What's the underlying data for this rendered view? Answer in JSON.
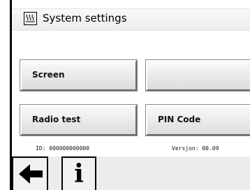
{
  "header": {
    "title": "System settings",
    "icon": "heater-icon"
  },
  "buttons": {
    "screen": "Screen",
    "blank": "",
    "radio_test": "Radio test",
    "pin_code": "PIN Code"
  },
  "footer_info": {
    "id": "ID: 000000000000",
    "version": "Versjon: 00.09"
  },
  "nav": {
    "back_icon": "arrow-left-icon",
    "info_icon": "info-icon",
    "info_glyph": "i"
  }
}
